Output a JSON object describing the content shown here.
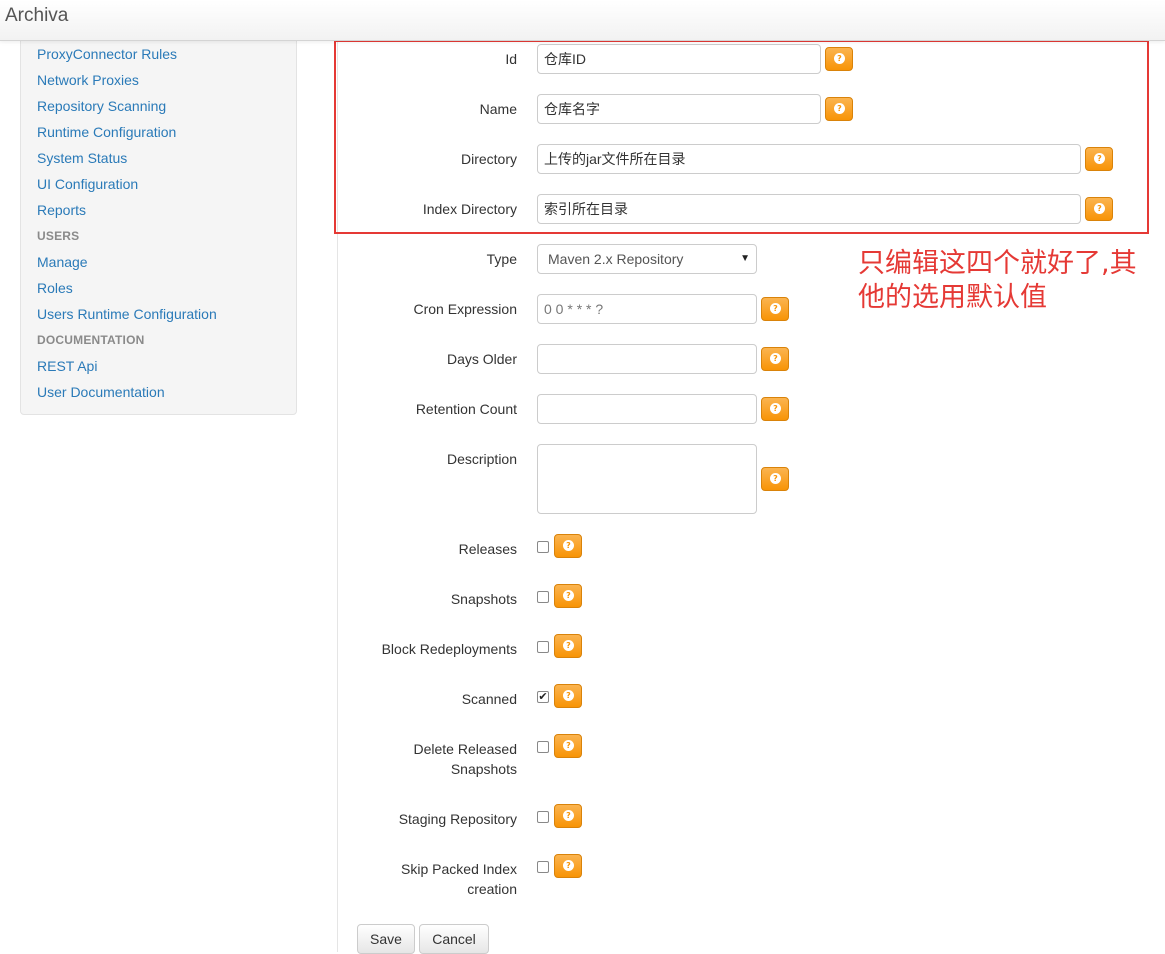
{
  "app": {
    "brand": "Archiva"
  },
  "sidebar": {
    "items_top": [
      "ProxyConnector Rules",
      "Network Proxies",
      "Repository Scanning",
      "Runtime Configuration",
      "System Status",
      "UI Configuration",
      "Reports"
    ],
    "users_header": "USERS",
    "users_items": [
      "Manage",
      "Roles",
      "Users Runtime Configuration"
    ],
    "docs_header": "DOCUMENTATION",
    "docs_items": [
      "REST Api",
      "User Documentation"
    ]
  },
  "form": {
    "id": {
      "label": "Id",
      "value": "仓库ID"
    },
    "name": {
      "label": "Name",
      "value": "仓库名字"
    },
    "directory": {
      "label": "Directory",
      "value": "上传的jar文件所在目录"
    },
    "index_directory": {
      "label": "Index Directory",
      "value": "索引所在目录"
    },
    "type": {
      "label": "Type",
      "value": "Maven 2.x Repository"
    },
    "cron": {
      "label": "Cron Expression",
      "value": "0 0 * * * ?"
    },
    "days_older": {
      "label": "Days Older",
      "value": ""
    },
    "retention_count": {
      "label": "Retention Count",
      "value": ""
    },
    "description": {
      "label": "Description",
      "value": ""
    },
    "releases": {
      "label": "Releases",
      "checked": false
    },
    "snapshots": {
      "label": "Snapshots",
      "checked": false
    },
    "block_redeployments": {
      "label": "Block Redeployments",
      "checked": false
    },
    "scanned": {
      "label": "Scanned",
      "checked": true
    },
    "delete_released_snapshots": {
      "label": "Delete Released Snapshots",
      "checked": false
    },
    "staging_repository": {
      "label": "Staging Repository",
      "checked": false
    },
    "skip_packed_index": {
      "label": "Skip Packed Index creation",
      "checked": false
    },
    "help_glyph": "?",
    "checkmark": "✔",
    "select_arrow": "▼"
  },
  "annotation": {
    "text": "只编辑这四个就好了,其他的选用默认值",
    "color": "#e53935"
  },
  "actions": {
    "save": "Save",
    "cancel": "Cancel"
  },
  "colors": {
    "link": "#2a7ab8",
    "help_button": "#f89406",
    "highlight_border": "#e53935"
  }
}
